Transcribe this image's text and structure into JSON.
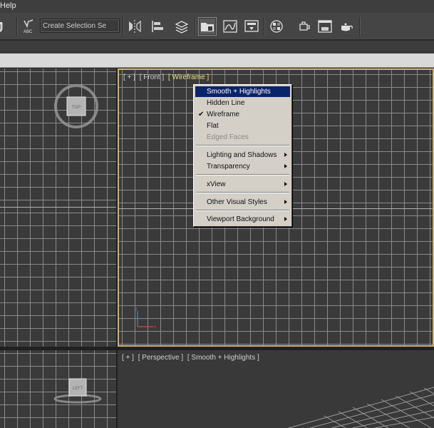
{
  "menubar": {
    "help_label": "Help"
  },
  "toolbar": {
    "abc_label": "ABC",
    "selection_set": {
      "value": "Create Selection Se",
      "placeholder": ""
    },
    "icons": [
      "magnet-icon",
      "snap-abc-icon",
      "mirror-icon",
      "align-icon",
      "layer-manager-icon",
      "scene-explorer-icon",
      "curve-editor-icon",
      "schematic-view-icon",
      "material-editor-icon",
      "render-setup-icon",
      "rendered-frame-window-icon",
      "render-production-icon"
    ]
  },
  "viewports": {
    "top": {
      "cube_label": "TOP"
    },
    "front": {
      "label_plus": "[ + ]",
      "label_view": "[ Front ]",
      "label_shading": "[ Wireframe ]"
    },
    "left": {
      "cube_label": "LEFT"
    },
    "perspective": {
      "label_plus": "[ + ]",
      "label_view": "[ Perspective ]",
      "label_shading": "[ Smooth + Highlights ]"
    }
  },
  "context_menu": {
    "items": [
      {
        "label": "Smooth + Highlights"
      },
      {
        "label": "Hidden Line"
      },
      {
        "label": "Wireframe"
      },
      {
        "label": "Flat"
      },
      {
        "label": "Edged Faces"
      },
      {
        "label": "Lighting and Shadows"
      },
      {
        "label": "Transparency"
      },
      {
        "label": "xView"
      },
      {
        "label": "Other Visual Styles"
      },
      {
        "label": "Viewport Background"
      }
    ],
    "checked_mark": "✔"
  },
  "colors": {
    "accent_border": "#c9b27a",
    "menu_highlight": "#0a246a",
    "label_highlight": "#f2e27a"
  }
}
